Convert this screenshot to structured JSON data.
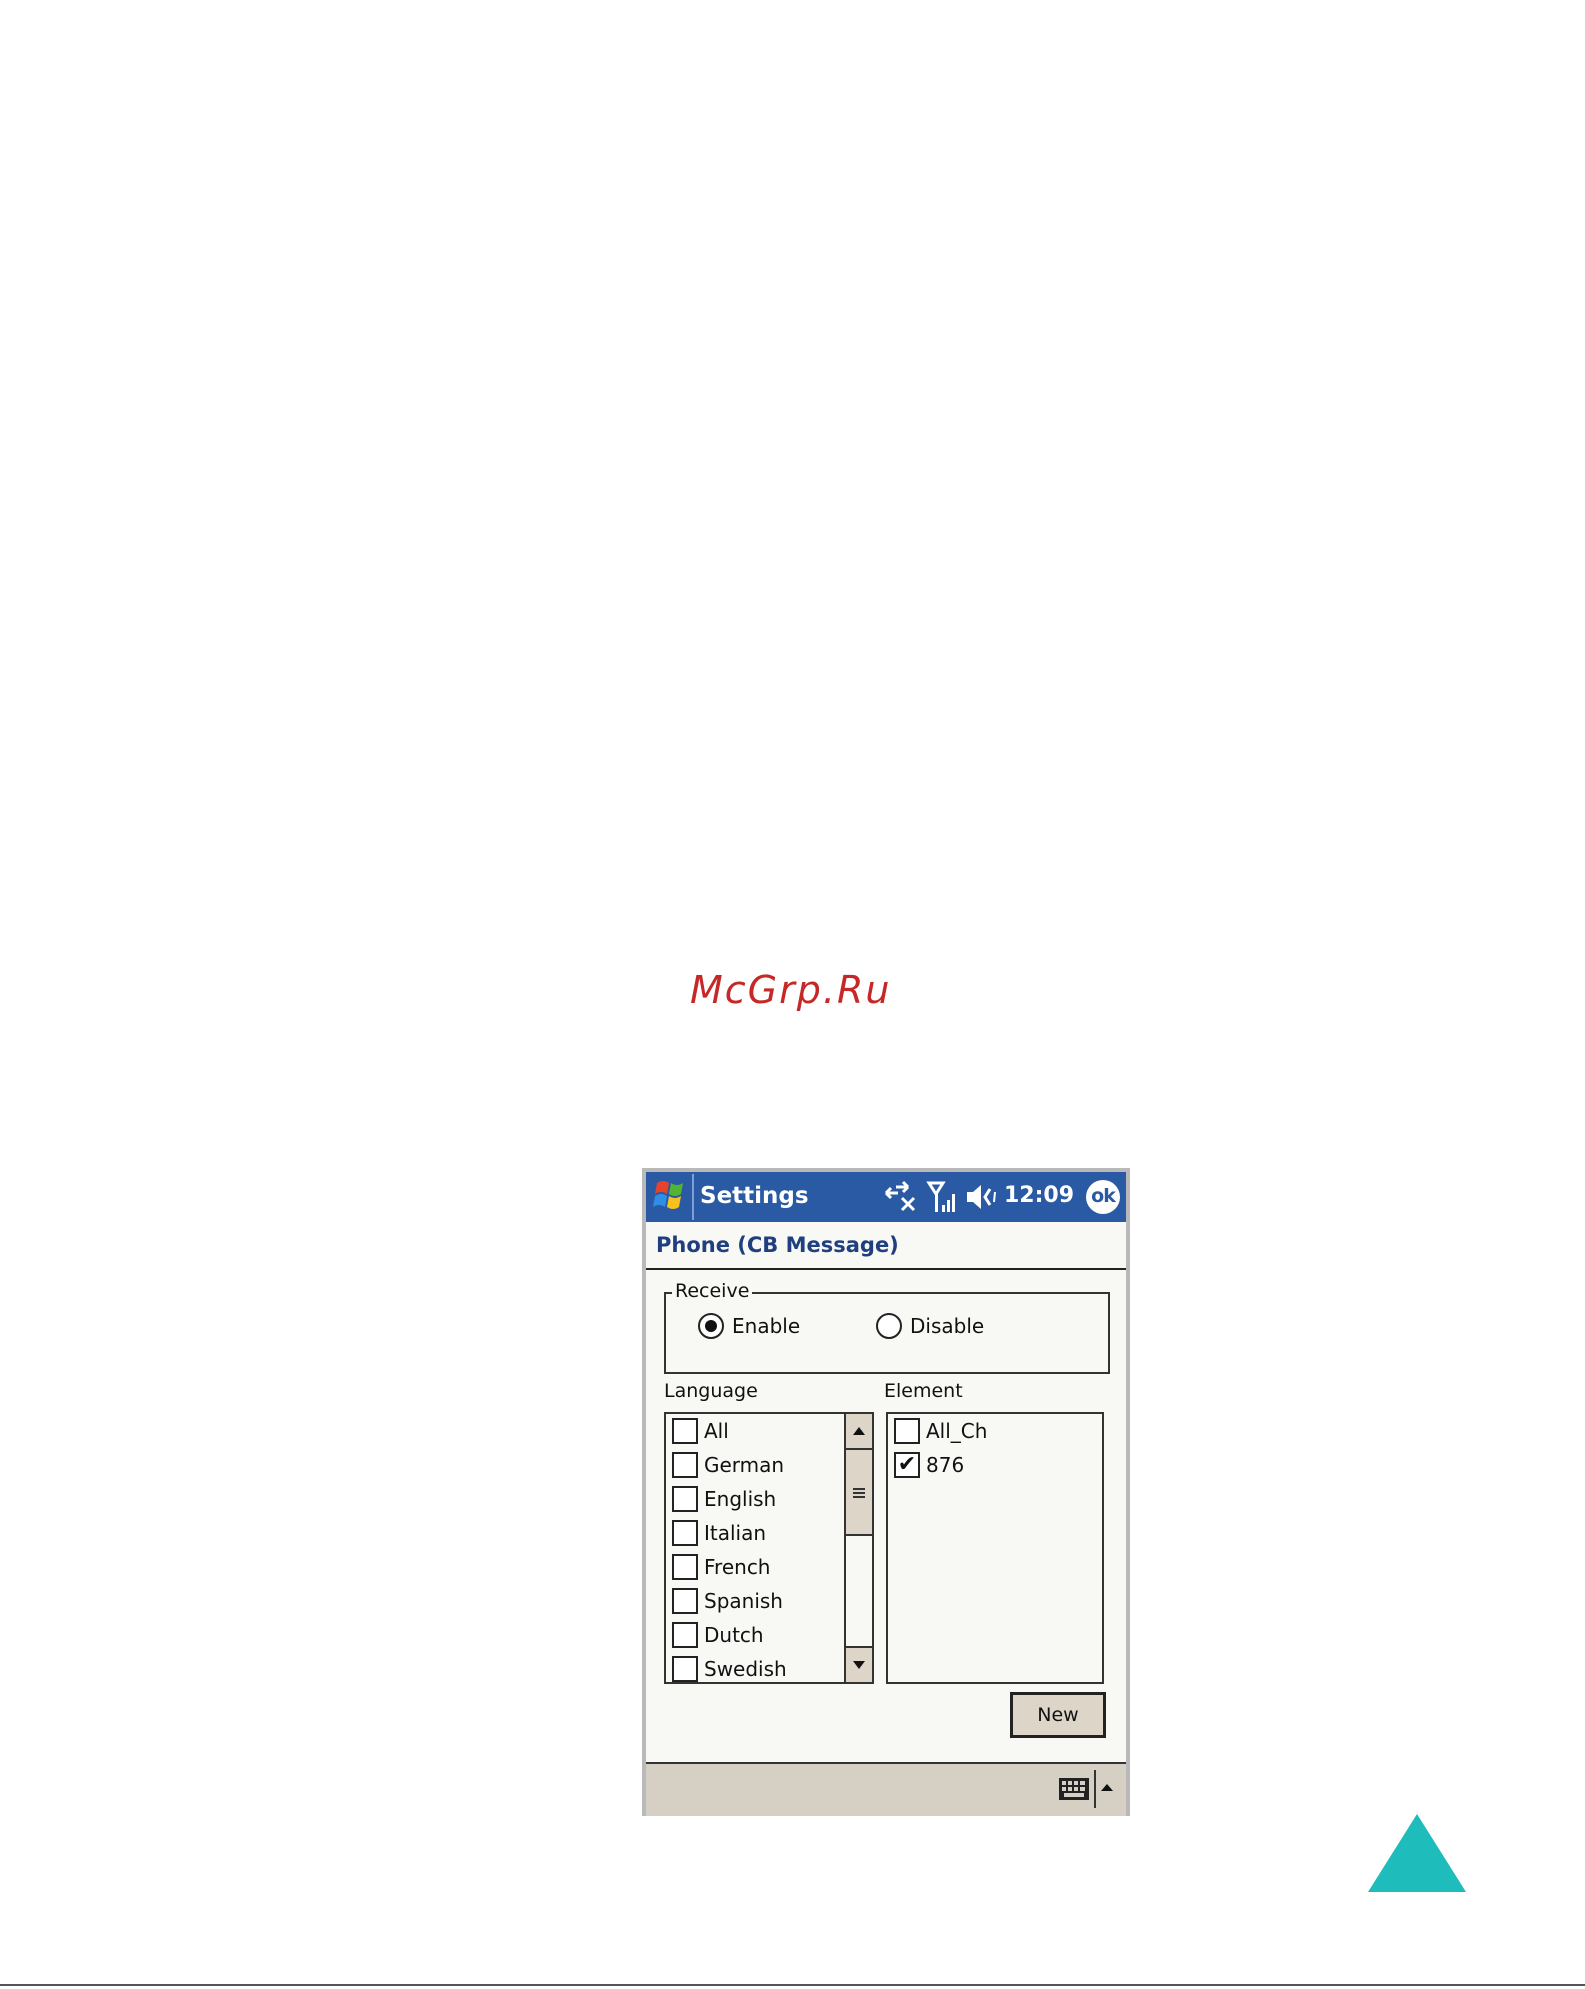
{
  "watermark": "McGrp.Ru",
  "window": {
    "title": "Settings",
    "time": "12:09",
    "ok_label": "ok",
    "icons": [
      "windows-start-icon",
      "connectivity-icon",
      "signal-icon",
      "volume-muted-icon"
    ]
  },
  "page": {
    "title": "Phone (CB Message)"
  },
  "receive": {
    "label": "Receive",
    "options": [
      {
        "label": "Enable",
        "selected": true
      },
      {
        "label": "Disable",
        "selected": false
      }
    ]
  },
  "language": {
    "label": "Language",
    "items": [
      {
        "label": "All",
        "checked": false
      },
      {
        "label": "German",
        "checked": false
      },
      {
        "label": "English",
        "checked": false
      },
      {
        "label": "Italian",
        "checked": false
      },
      {
        "label": "French",
        "checked": false
      },
      {
        "label": "Spanish",
        "checked": false
      },
      {
        "label": "Dutch",
        "checked": false
      },
      {
        "label": "Swedish",
        "checked": false
      }
    ]
  },
  "element": {
    "label": "Element",
    "items": [
      {
        "label": "All_Ch",
        "checked": false
      },
      {
        "label": "876",
        "checked": true
      }
    ]
  },
  "buttons": {
    "new_label": "New"
  },
  "colors": {
    "titlebar": "#2b5aa4",
    "watermark": "#c62828",
    "nav_triangle": "#1fbcbc",
    "menubar": "#d6cfc3"
  }
}
